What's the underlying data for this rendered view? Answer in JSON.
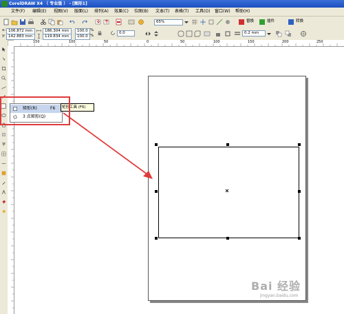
{
  "window": {
    "title": "CorelDRAW X4 （ 专业版 ） - [图形1]"
  },
  "menu": [
    {
      "id": "file",
      "label": "文件(F)"
    },
    {
      "id": "edit",
      "label": "编辑(E)"
    },
    {
      "id": "view",
      "label": "视图(V)"
    },
    {
      "id": "layout",
      "label": "版面(L)"
    },
    {
      "id": "arrange",
      "label": "排列(A)"
    },
    {
      "id": "effects",
      "label": "效果(C)"
    },
    {
      "id": "bitmaps",
      "label": "位图(B)"
    },
    {
      "id": "text",
      "label": "文本(T)"
    },
    {
      "id": "table",
      "label": "表格(T)"
    },
    {
      "id": "tools",
      "label": "工具(O)"
    },
    {
      "id": "window",
      "label": "窗口(W)"
    },
    {
      "id": "help",
      "label": "帮助(H)"
    }
  ],
  "toolbar": {
    "zoom": "65%",
    "launcher_label": "替换",
    "plugin_label": "插件",
    "convert_label": "转换"
  },
  "properties": {
    "x": "106.872 mm",
    "y": "142.883 mm",
    "width": "186.304 mm",
    "height": "119.834 mm",
    "scale_x": "100.0",
    "scale_y": "100.0",
    "percent": "%",
    "rotation": "0.0",
    "outline": "0.2 mm"
  },
  "ruler": {
    "h_ticks": [
      "150",
      "100",
      "50",
      "0",
      "50",
      "100",
      "150",
      "200",
      "250"
    ]
  },
  "flyout": {
    "rect_label": "矩形(R)",
    "rect_shortcut": "F6",
    "rect3_label": "3 点矩形(Q)",
    "tooltip": "矩形工具 (F6)"
  },
  "watermark": {
    "text": "Bai 经验",
    "sub": "jingyan.baidu.com"
  },
  "colors": {
    "accent_highlight": "#e03a3a",
    "titlebar": "#1c4fc0"
  }
}
